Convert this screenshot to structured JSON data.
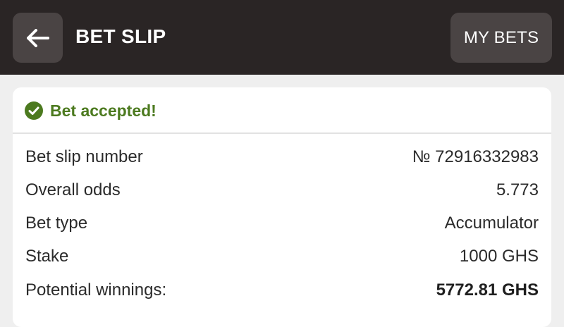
{
  "header": {
    "back_icon": "arrow-left-icon",
    "title": "BET SLIP",
    "my_bets_label": "MY BETS"
  },
  "status": {
    "icon": "check-circle-icon",
    "text": "Bet accepted!",
    "color": "#4c7a1f"
  },
  "details": [
    {
      "label": "Bet slip number",
      "value": "№ 72916332983"
    },
    {
      "label": "Overall odds",
      "value": "5.773"
    },
    {
      "label": "Bet type",
      "value": "Accumulator"
    },
    {
      "label": "Stake",
      "value": "1000 GHS"
    },
    {
      "label": "Potential winnings:",
      "value": "5772.81 GHS"
    }
  ],
  "colors": {
    "header_bg": "#2a2525",
    "button_bg": "#4a4444",
    "page_bg": "#efefef",
    "accent_green": "#4c7a1f"
  }
}
